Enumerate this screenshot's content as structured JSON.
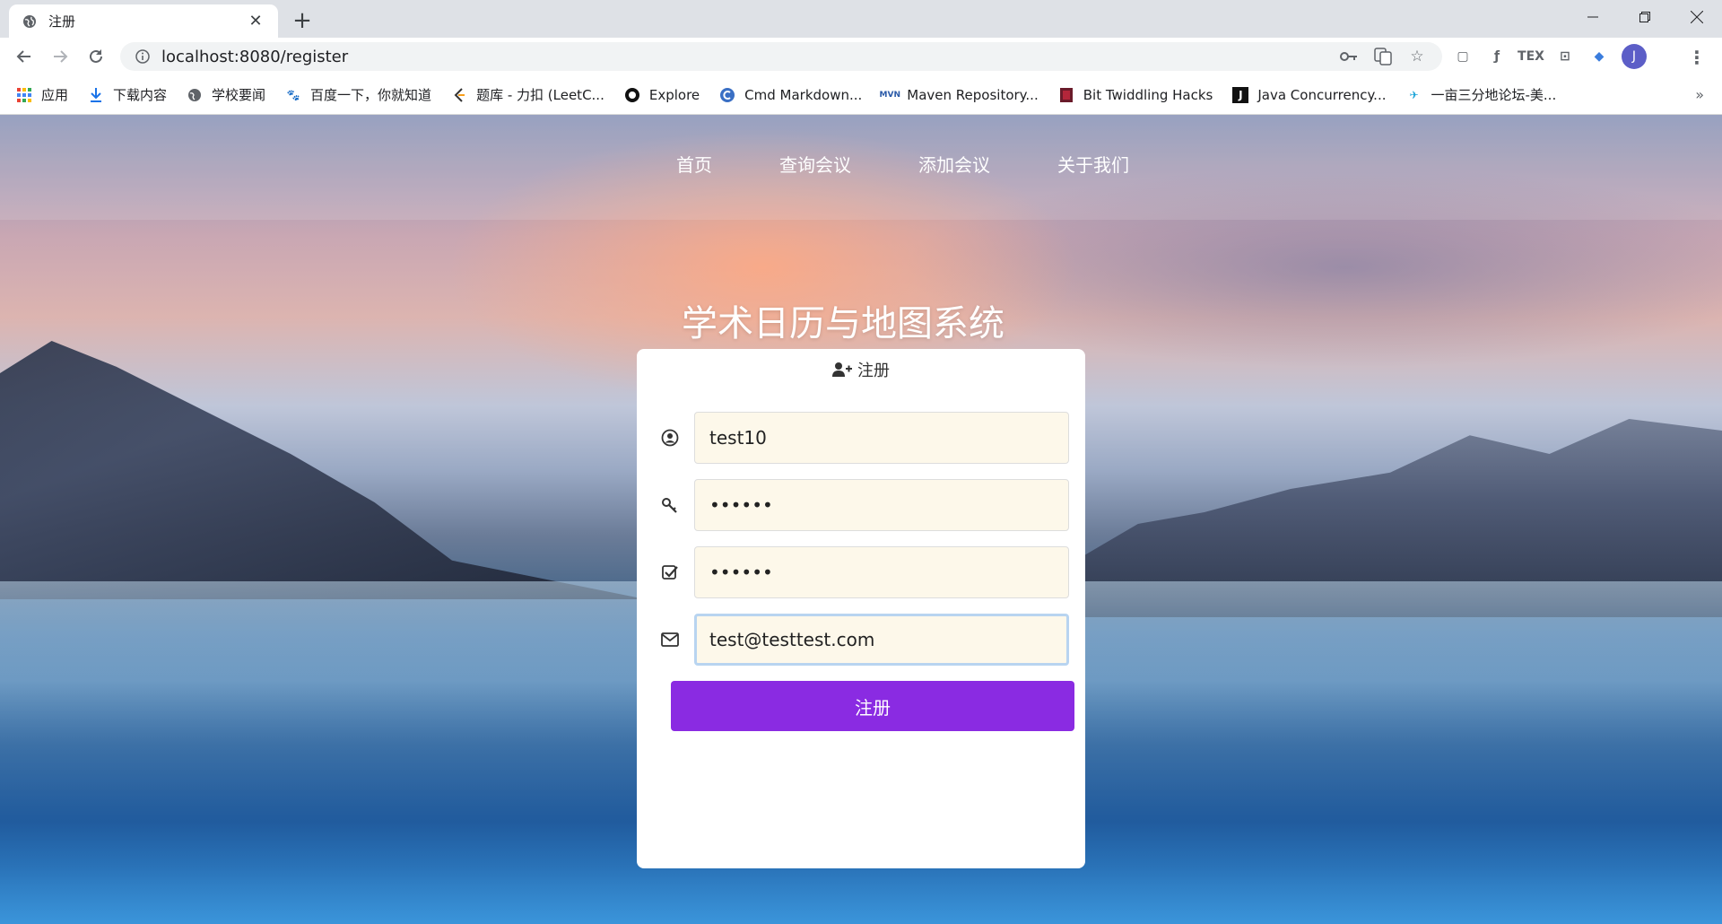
{
  "browser": {
    "tab_title": "注册",
    "url": "localhost:8080/register",
    "avatar_letter": "J",
    "bookmarks": [
      {
        "label": "应用",
        "icon": "apps-grid-icon"
      },
      {
        "label": "下载内容",
        "icon": "download-icon"
      },
      {
        "label": "学校要闻",
        "icon": "globe-icon"
      },
      {
        "label": "百度一下，你就知道",
        "icon": "baidu-paw-icon"
      },
      {
        "label": "题库 - 力扣 (LeetC...",
        "icon": "leetcode-icon"
      },
      {
        "label": "Explore",
        "icon": "github-icon"
      },
      {
        "label": "Cmd Markdown...",
        "icon": "cmd-markdown-icon"
      },
      {
        "label": "Maven Repository...",
        "icon": "mvn-icon"
      },
      {
        "label": "Bit Twiddling Hacks",
        "icon": "bit-twiddling-icon"
      },
      {
        "label": "Java Concurrency...",
        "icon": "j-icon"
      },
      {
        "label": "一亩三分地论坛-美...",
        "icon": "forum-icon"
      }
    ]
  },
  "nav": {
    "home": "首页",
    "query": "查询会议",
    "add": "添加会议",
    "about": "关于我们"
  },
  "site_title": "学术日历与地图系统",
  "form": {
    "header": "注册",
    "username": "test10",
    "password": "••••••",
    "confirm_password": "••••••",
    "email": "test@testtest.com",
    "submit_label": "注册"
  },
  "colors": {
    "accent": "#8a2be2",
    "input_bg": "#fdf8ea"
  }
}
